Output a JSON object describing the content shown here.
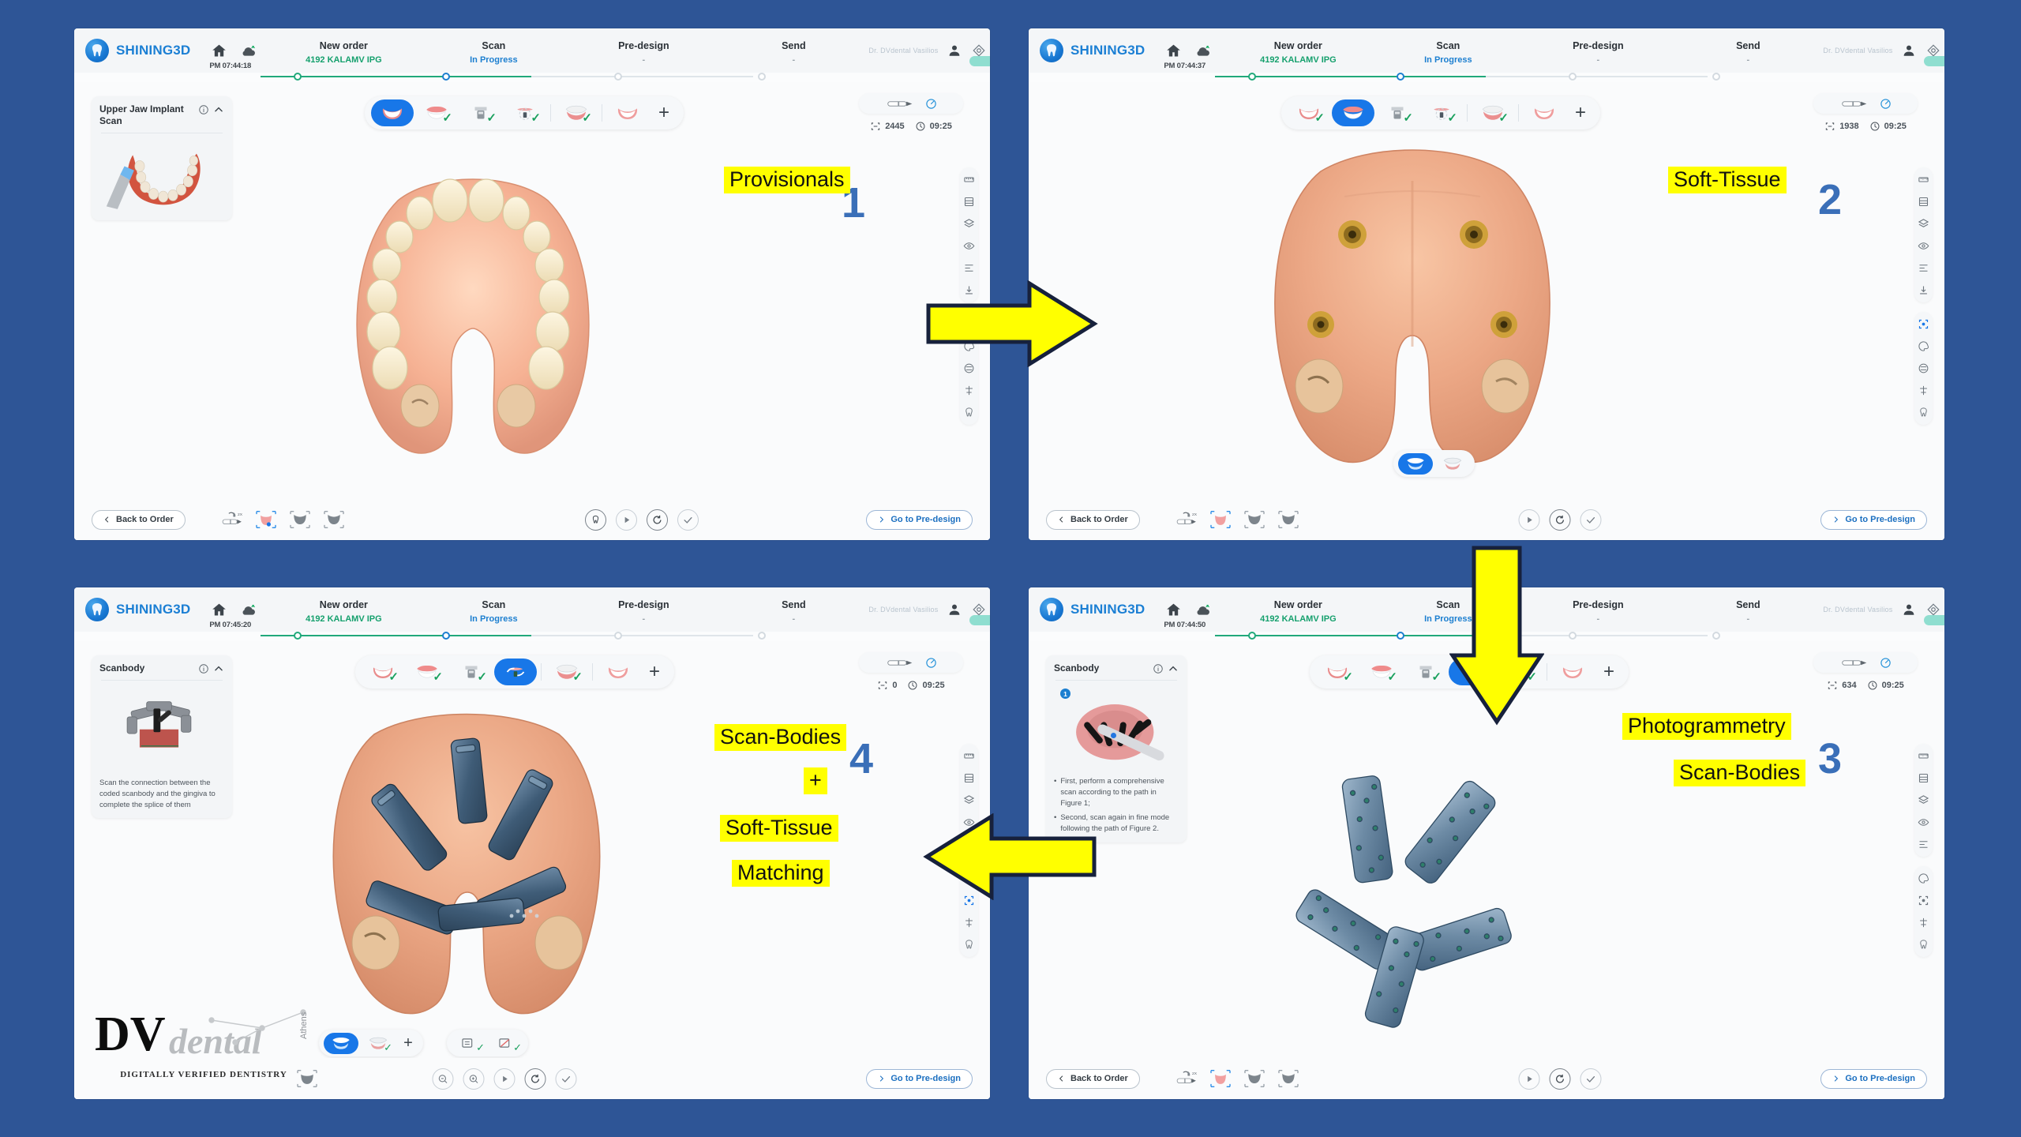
{
  "app": {
    "brand": "SHINING3D",
    "logo_icon": "tooth-icon",
    "accent_blue": "#1877e8",
    "accent_green": "#21a97b",
    "title_bar_bg": "#f4f6f8",
    "page_bg": "#2e5596"
  },
  "header_icons": {
    "home": "home-icon",
    "cloud": "cloud-wifi-icon",
    "user": "user-icon",
    "calibrate": "calibration-icon",
    "screenshot": "screenshot-icon",
    "settings": "gear-icon",
    "help": "question-mark-icon",
    "minimize": "minimize-icon",
    "close": "close-icon"
  },
  "steps_labels": {
    "new_order": "New order",
    "scan": "Scan",
    "predesign": "Pre-design",
    "send": "Send",
    "order_id": "4192 KALAMV IPG",
    "in_progress": "In Progress",
    "dash": "-"
  },
  "buttons": {
    "back_to_order": "Back to Order",
    "go_to_predesign": "Go to Pre-design",
    "plus": "+"
  },
  "panels": [
    {
      "id": "panel-1",
      "number": "1",
      "timestamp": "PM 07:44:18",
      "user": "Dr. DVdental Vasilios",
      "sidecard": {
        "title": "Upper Jaw Implant Scan",
        "info_icon": "info-icon",
        "collapse_icon": "chevron-up-icon",
        "body_text": "",
        "image_alt": "lower-arch-scan-preview"
      },
      "active_tool_index": 0,
      "tools": [
        {
          "icon": "upper-jaw-icon",
          "checked": false
        },
        {
          "icon": "lower-jaw-icon",
          "checked": true
        },
        {
          "icon": "bite-scan-icon",
          "checked": true
        },
        {
          "icon": "emergence-profile-icon",
          "checked": true
        },
        {
          "icon": "full-denture-icon",
          "checked": true
        },
        {
          "icon": "gingiva-icon",
          "checked": false
        }
      ],
      "metrics": {
        "frames_icon": "frame-count-icon",
        "frames": "2445",
        "clock_icon": "clock-icon",
        "time": "09:25"
      },
      "note": "Provisionals",
      "note_lines": [
        "Provisionals"
      ]
    },
    {
      "id": "panel-2",
      "number": "2",
      "timestamp": "PM 07:44:37",
      "user": "Dr. DVdental Vasilios",
      "sidecard": null,
      "active_tool_index": 1,
      "tools": [
        {
          "icon": "upper-jaw-icon",
          "checked": true
        },
        {
          "icon": "lower-jaw-icon",
          "checked": false
        },
        {
          "icon": "bite-scan-icon",
          "checked": true
        },
        {
          "icon": "emergence-profile-icon",
          "checked": true
        },
        {
          "icon": "full-denture-icon",
          "checked": true
        },
        {
          "icon": "gingiva-icon",
          "checked": false
        }
      ],
      "metrics": {
        "frames_icon": "frame-count-icon",
        "frames": "1938",
        "clock_icon": "clock-icon",
        "time": "09:25"
      },
      "note": "Soft-Tissue",
      "note_lines": [
        "Soft-Tissue"
      ]
    },
    {
      "id": "panel-3",
      "number": "4",
      "timestamp": "PM 07:45:20",
      "user": "Dr. DVdental Vasilios",
      "sidecard": {
        "title": "Scanbody",
        "info_icon": "info-icon",
        "collapse_icon": "chevron-up-icon",
        "body_text": "Scan the connection between the coded scanbody and the gingiva to complete the splice of them",
        "image_alt": "scanbody-gingiva-preview"
      },
      "active_tool_index": 3,
      "tools": [
        {
          "icon": "upper-jaw-icon",
          "checked": true
        },
        {
          "icon": "lower-jaw-icon",
          "checked": true
        },
        {
          "icon": "bite-scan-icon",
          "checked": true
        },
        {
          "icon": "scanbody-splice-icon",
          "checked": false
        },
        {
          "icon": "full-denture-icon",
          "checked": true
        },
        {
          "icon": "gingiva-icon",
          "checked": false
        }
      ],
      "metrics": {
        "frames_icon": "frame-count-icon",
        "frames": "0",
        "clock_icon": "clock-icon",
        "time": "09:25"
      },
      "note_lines": [
        "Scan-Bodies",
        "+",
        "Soft-Tissue",
        "Matching"
      ]
    },
    {
      "id": "panel-4",
      "number": "3",
      "timestamp": "PM 07:44:50",
      "user": "Dr. DVdental Vasilios",
      "sidecard": {
        "title": "Scanbody",
        "info_icon": "info-icon",
        "collapse_icon": "chevron-up-icon",
        "badge": "1",
        "bullets": [
          "First, perform a comprehensive scan according to the path in Figure 1;",
          "Second, scan again in fine mode following the path of Figure 2."
        ],
        "image_alt": "photogrammetry-scanbody-preview"
      },
      "active_tool_index": 3,
      "tools": [
        {
          "icon": "upper-jaw-icon",
          "checked": true
        },
        {
          "icon": "lower-jaw-icon",
          "checked": true
        },
        {
          "icon": "bite-scan-icon",
          "checked": true
        },
        {
          "icon": "scanbody-splice-icon",
          "checked": false
        },
        {
          "icon": "full-denture-icon",
          "checked": true
        },
        {
          "icon": "gingiva-icon",
          "checked": false
        }
      ],
      "metrics": {
        "frames_icon": "frame-count-icon",
        "frames": "634",
        "clock_icon": "clock-icon",
        "time": "09:25"
      },
      "note_lines": [
        "Photogrammetry",
        "Scan-Bodies"
      ]
    }
  ],
  "watermark": {
    "dv": "DV",
    "dental": "dental",
    "athens": "Athens",
    "tagline": "DIGITALLY  VERIFIED  DENTISTRY"
  },
  "flow_arrows": [
    {
      "name": "arrow-right-1-to-2",
      "direction": "right"
    },
    {
      "name": "arrow-down-2-to-3",
      "direction": "down"
    },
    {
      "name": "arrow-left-3-to-4",
      "direction": "left"
    }
  ]
}
